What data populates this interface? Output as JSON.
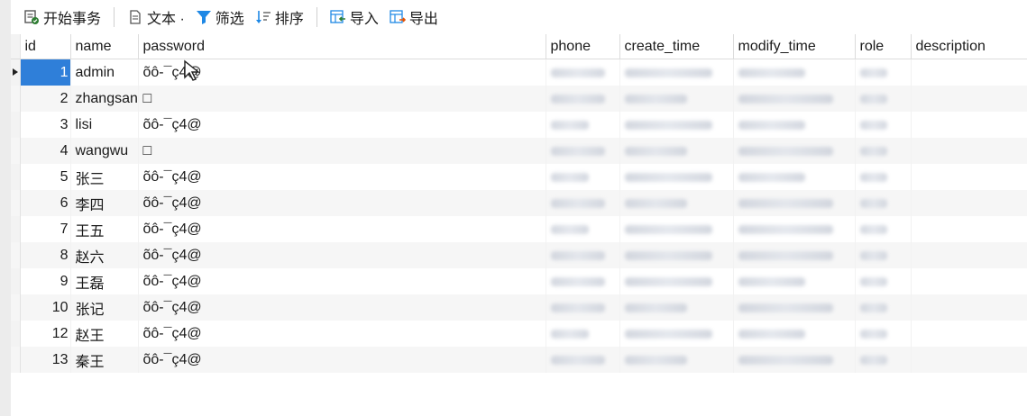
{
  "toolbar": {
    "begin_transaction": "开始事务",
    "text": "文本 ·",
    "filter": "筛选",
    "sort": "排序",
    "import": "导入",
    "export": "导出"
  },
  "columns": [
    "id",
    "name",
    "password",
    "phone",
    "create_time",
    "modify_time",
    "role",
    "description"
  ],
  "rows": [
    {
      "id": "1",
      "name": "admin",
      "password": "õô-¯ç4@"
    },
    {
      "id": "2",
      "name": "zhangsan",
      "password": "□"
    },
    {
      "id": "3",
      "name": "lisi",
      "password": "õô-¯ç4@"
    },
    {
      "id": "4",
      "name": "wangwu",
      "password": "□"
    },
    {
      "id": "5",
      "name": "张三",
      "password": "õô-¯ç4@"
    },
    {
      "id": "6",
      "name": "李四",
      "password": "õô-¯ç4@"
    },
    {
      "id": "7",
      "name": "王五",
      "password": "õô-¯ç4@"
    },
    {
      "id": "8",
      "name": "赵六",
      "password": "õô-¯ç4@"
    },
    {
      "id": "9",
      "name": "王磊",
      "password": "õô-¯ç4@"
    },
    {
      "id": "10",
      "name": "张记",
      "password": "õô-¯ç4@"
    },
    {
      "id": "12",
      "name": "赵王",
      "password": "õô-¯ç4@"
    },
    {
      "id": "13",
      "name": "秦王",
      "password": "õô-¯ç4@"
    }
  ],
  "selected_row_id": "1",
  "colors": {
    "accent": "#2f7fd9",
    "filter_icon": "#1e88e5",
    "import_icon": "#2e7d32",
    "export_icon": "#1e88e5"
  }
}
